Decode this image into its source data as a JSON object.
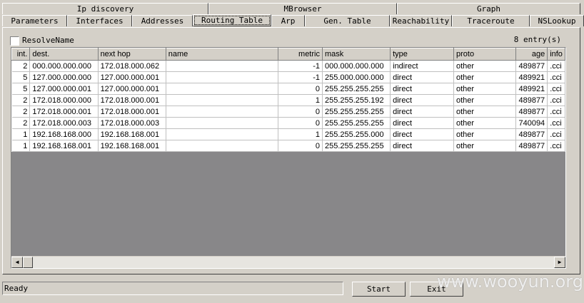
{
  "tabs_row1": [
    "Ip discovery",
    "MBrowser",
    "Graph"
  ],
  "tabs_row2": [
    "Parameters",
    "Interfaces",
    "Addresses",
    "Routing Table",
    "Arp",
    "Gen. Table",
    "Reachability",
    "Traceroute",
    "NSLookup"
  ],
  "active_tab": "Routing Table",
  "resolve_label": "ResolveName",
  "entries": "8 entry(s)",
  "columns": [
    "int.",
    "dest.",
    "next hop",
    "name",
    "metric",
    "mask",
    "type",
    "proto",
    "age",
    "info"
  ],
  "rows": [
    [
      "2",
      "000.000.000.000",
      "172.018.000.062",
      "",
      "-1",
      "000.000.000.000",
      "indirect",
      "other",
      "489877",
      ".cci"
    ],
    [
      "5",
      "127.000.000.000",
      "127.000.000.001",
      "",
      "-1",
      "255.000.000.000",
      "direct",
      "other",
      "489921",
      ".cci"
    ],
    [
      "5",
      "127.000.000.001",
      "127.000.000.001",
      "",
      "0",
      "255.255.255.255",
      "direct",
      "other",
      "489921",
      ".cci"
    ],
    [
      "2",
      "172.018.000.000",
      "172.018.000.001",
      "",
      "1",
      "255.255.255.192",
      "direct",
      "other",
      "489877",
      ".cci"
    ],
    [
      "2",
      "172.018.000.001",
      "172.018.000.001",
      "",
      "0",
      "255.255.255.255",
      "direct",
      "other",
      "489877",
      ".cci"
    ],
    [
      "2",
      "172.018.000.003",
      "172.018.000.003",
      "",
      "0",
      "255.255.255.255",
      "direct",
      "other",
      "740094",
      ".cci"
    ],
    [
      "1",
      "192.168.168.000",
      "192.168.168.001",
      "",
      "1",
      "255.255.255.000",
      "direct",
      "other",
      "489877",
      ".cci"
    ],
    [
      "1",
      "192.168.168.001",
      "192.168.168.001",
      "",
      "0",
      "255.255.255.255",
      "direct",
      "other",
      "489877",
      ".cci"
    ]
  ],
  "status": "Ready",
  "start_label": "Start",
  "exit_label": "Exit",
  "watermark": "www.wooyun.org"
}
